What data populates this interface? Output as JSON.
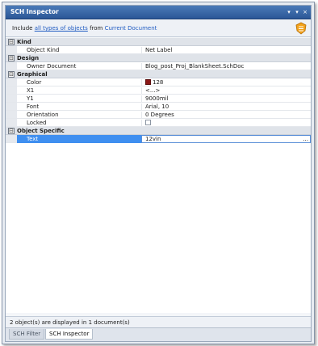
{
  "window": {
    "title": "SCH Inspector"
  },
  "filter": {
    "prefix": "Include",
    "scope_link": "all types of objects",
    "from_label": "from",
    "source_link": "Current Document"
  },
  "categories": {
    "kind": {
      "label": "Kind",
      "toggle": "⊟"
    },
    "design": {
      "label": "Design",
      "toggle": "⊟"
    },
    "graphical": {
      "label": "Graphical",
      "toggle": "⊟"
    },
    "object_specific": {
      "label": "Object Specific",
      "toggle": "⊟"
    }
  },
  "rows": {
    "object_kind": {
      "name": "Object Kind",
      "value": "Net Label"
    },
    "owner_document": {
      "name": "Owner Document",
      "value": "Blog_post_Proj_BlankSheet.SchDoc"
    },
    "color": {
      "name": "Color",
      "value": "128",
      "swatch_color": "#8b1616"
    },
    "x1": {
      "name": "X1",
      "value": "<...>"
    },
    "y1": {
      "name": "Y1",
      "value": "9000mil"
    },
    "font": {
      "name": "Font",
      "value": "Arial, 10"
    },
    "orientation": {
      "name": "Orientation",
      "value": "0 Degrees"
    },
    "locked": {
      "name": "Locked",
      "checked": false
    },
    "text": {
      "name": "Text",
      "value": "12vin",
      "ellipsis": "..."
    }
  },
  "status": {
    "text": "2 object(s) are displayed in 1 document(s)"
  },
  "tabs": [
    {
      "label": "SCH Filter",
      "active": false
    },
    {
      "label": "SCH Inspector",
      "active": true
    }
  ],
  "title_buttons": {
    "menu": "▾",
    "pin": "▾",
    "close": "×"
  },
  "colors": {
    "accent": "#2b5797",
    "selection": "#3f8ff0",
    "link": "#1f5bc2"
  }
}
